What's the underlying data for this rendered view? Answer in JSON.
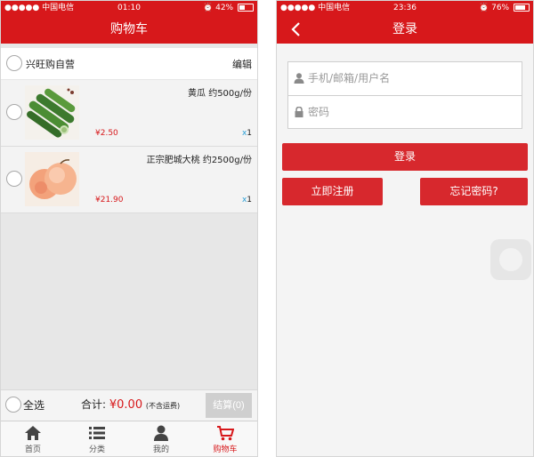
{
  "left": {
    "status": {
      "carrier": "●●●●● 中国电信",
      "time": "01:10",
      "battery": "42%",
      "battery_level": 0.42
    },
    "title": "购物车",
    "store": {
      "name": "兴旺购自营",
      "edit": "编辑"
    },
    "items": [
      {
        "name": "黄瓜 约500g/份",
        "price": "¥2.50",
        "qty_x": "x",
        "qty": "1",
        "image": "cucumber-image"
      },
      {
        "name": "正宗肥城大桃 约2500g/份",
        "price": "¥21.90",
        "qty_x": "x",
        "qty": "1",
        "image": "peach-image"
      }
    ],
    "footer": {
      "select_all": "全选",
      "total_label": "合计:",
      "total_amount": "¥0.00",
      "total_note": "(不含运费)",
      "checkout": "结算(0)"
    },
    "tabs": [
      {
        "label": "首页",
        "icon": "home-icon"
      },
      {
        "label": "分类",
        "icon": "list-icon"
      },
      {
        "label": "我的",
        "icon": "user-icon"
      },
      {
        "label": "购物车",
        "icon": "cart-icon",
        "active": true
      }
    ],
    "colors": {
      "brand": "#d7181b",
      "checkout_disabled": "#cfcfcf"
    }
  },
  "right": {
    "status": {
      "carrier": "●●●●● 中国电信",
      "time": "23:36",
      "battery": "76%",
      "battery_level": 0.76
    },
    "title": "登录",
    "username_placeholder": "手机/邮箱/用户名",
    "password_placeholder": "密码",
    "login": "登录",
    "register": "立即注册",
    "forgot": "忘记密码?",
    "colors": {
      "button": "#d7282d"
    }
  }
}
